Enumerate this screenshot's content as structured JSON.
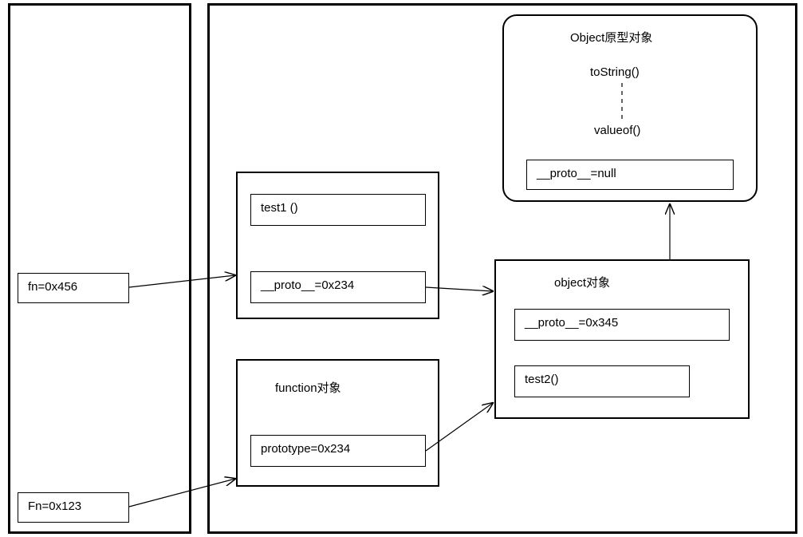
{
  "left": {
    "fn": "fn=0x456",
    "Fn": "Fn=0x123"
  },
  "middle": {
    "inst": {
      "test1": "test1 ()",
      "proto": "__proto__=0x234"
    },
    "func": {
      "title": "function对象",
      "prototype": "prototype=0x234"
    }
  },
  "right": {
    "objproto": {
      "title": "Object原型对象",
      "toString": "toString()",
      "valueof": "valueof()",
      "proto": "__proto__=null"
    },
    "obj": {
      "title": "object对象",
      "proto": "__proto__=0x345",
      "test2": "test2()"
    }
  }
}
